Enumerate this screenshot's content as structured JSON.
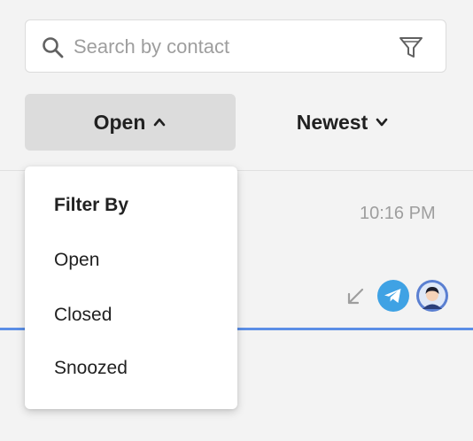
{
  "search": {
    "placeholder": "Search by contact"
  },
  "toolbar": {
    "status_label": "Open",
    "sort_label": "Newest"
  },
  "conversation": {
    "time": "10:16 PM",
    "channel": "telegram-icon",
    "direction": "incoming-arrow-icon"
  },
  "filter_menu": {
    "header": "Filter By",
    "items": [
      {
        "label": "Open"
      },
      {
        "label": "Closed"
      },
      {
        "label": "Snoozed"
      }
    ]
  },
  "colors": {
    "accent": "#5b8ee6",
    "telegram": "#3fa2e4",
    "avatar_bg": "#5a7fd1"
  }
}
